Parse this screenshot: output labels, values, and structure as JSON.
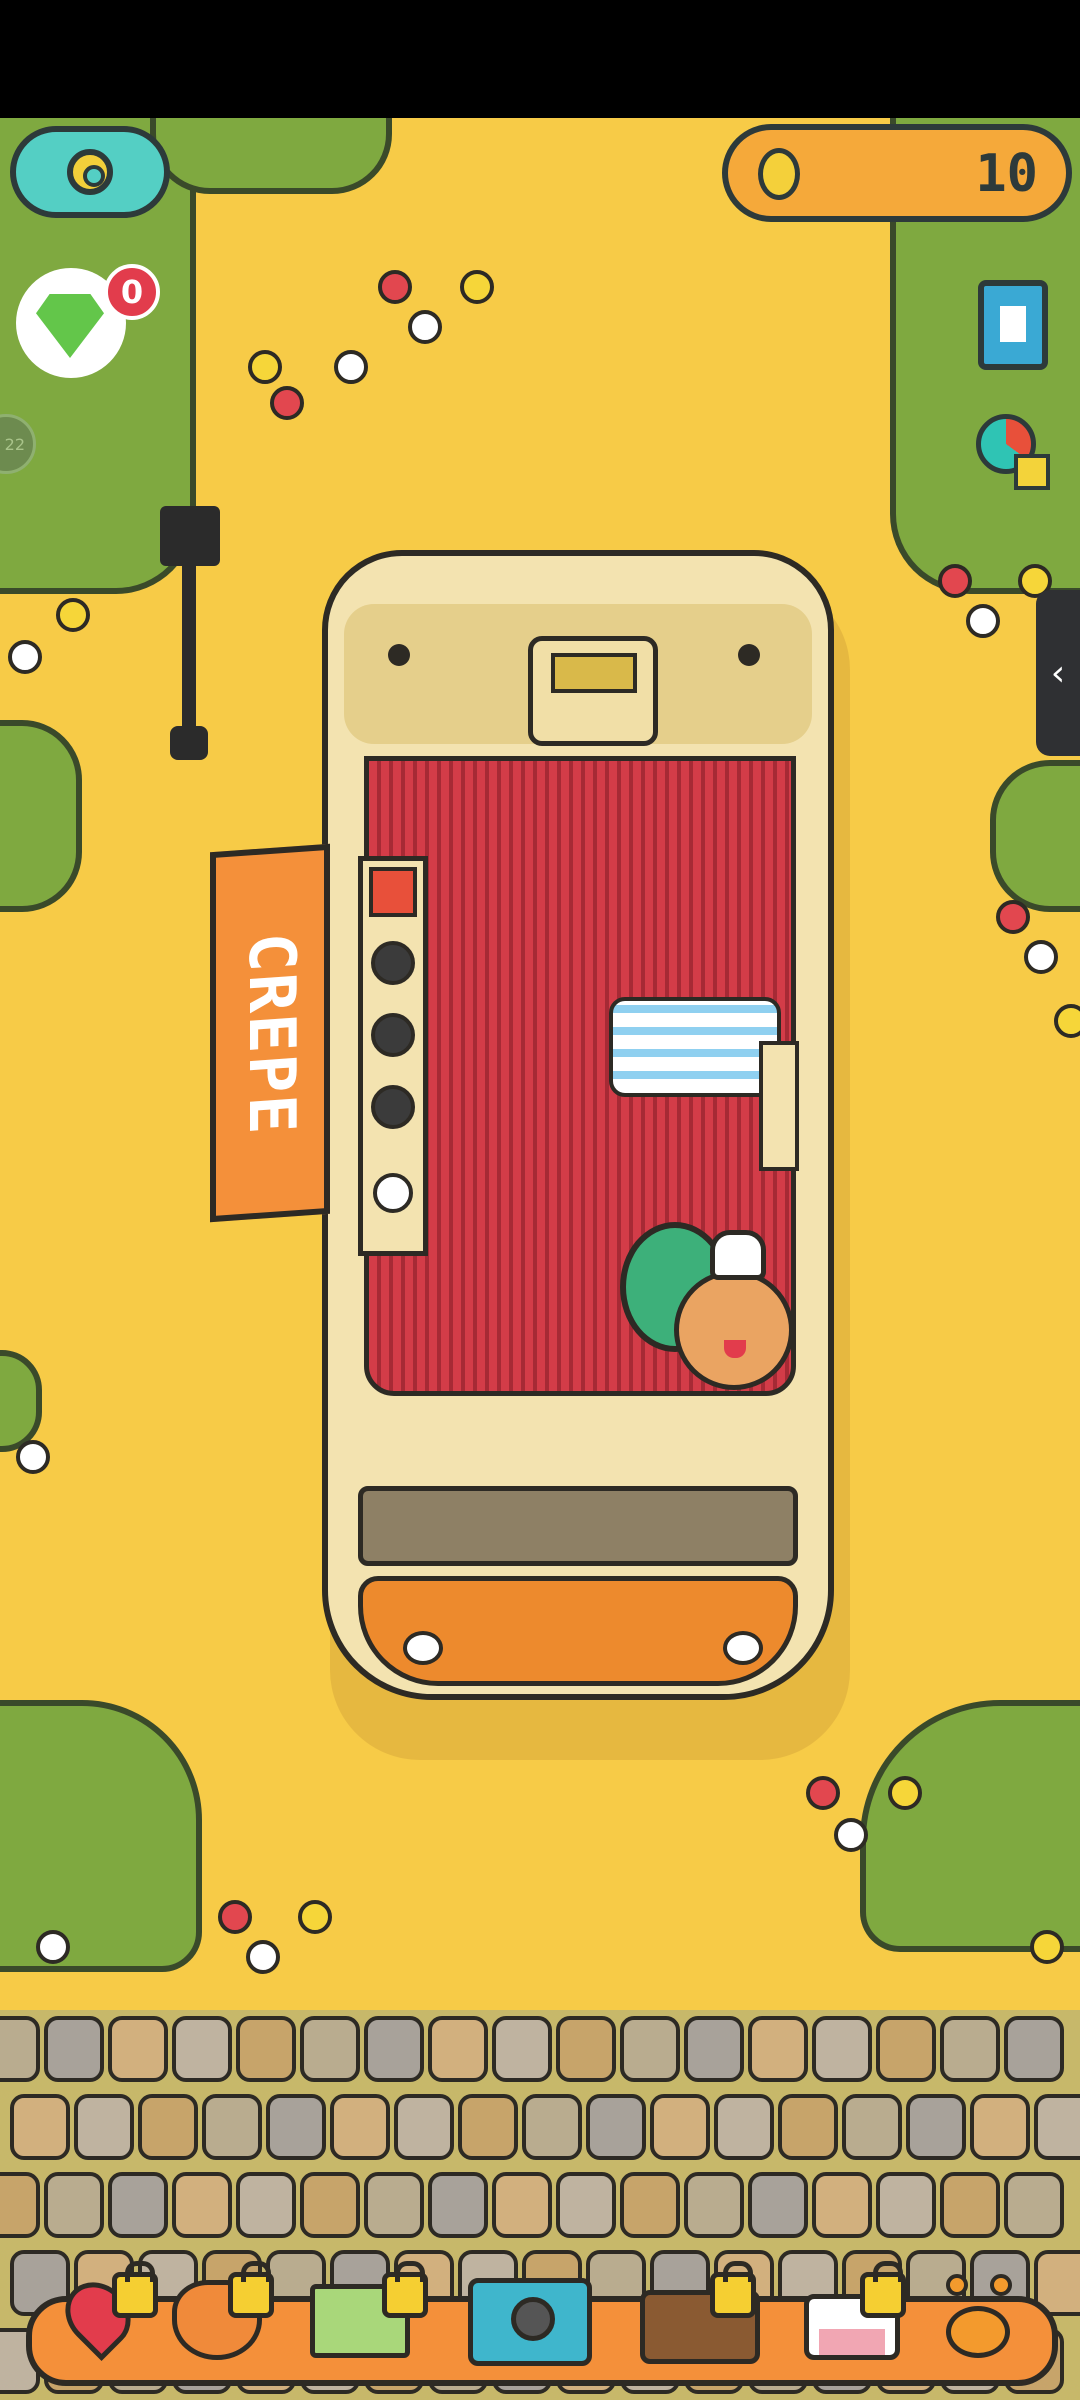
{
  "hud": {
    "coins": "10",
    "gem_badge": "0",
    "level_circle": "22",
    "drawer_arrow": "‹"
  },
  "shop": {
    "sign_text": "CREPE"
  },
  "toolbar": {
    "tools": [
      {
        "name": "map-pin-tool",
        "locked": true
      },
      {
        "name": "shiba-dog-tool",
        "locked": true
      },
      {
        "name": "cash-register-tool",
        "locked": true
      },
      {
        "name": "camera-tool",
        "locked": false
      },
      {
        "name": "sofa-tool",
        "locked": true
      },
      {
        "name": "bed-tool",
        "locked": true
      },
      {
        "name": "paw-tool",
        "locked": false
      }
    ]
  },
  "colors": {
    "ground": "#f7cb47",
    "grass": "#7fa940",
    "accent_orange": "#f4903a",
    "teal": "#54cfc4",
    "badge_red": "#e23c4c"
  }
}
